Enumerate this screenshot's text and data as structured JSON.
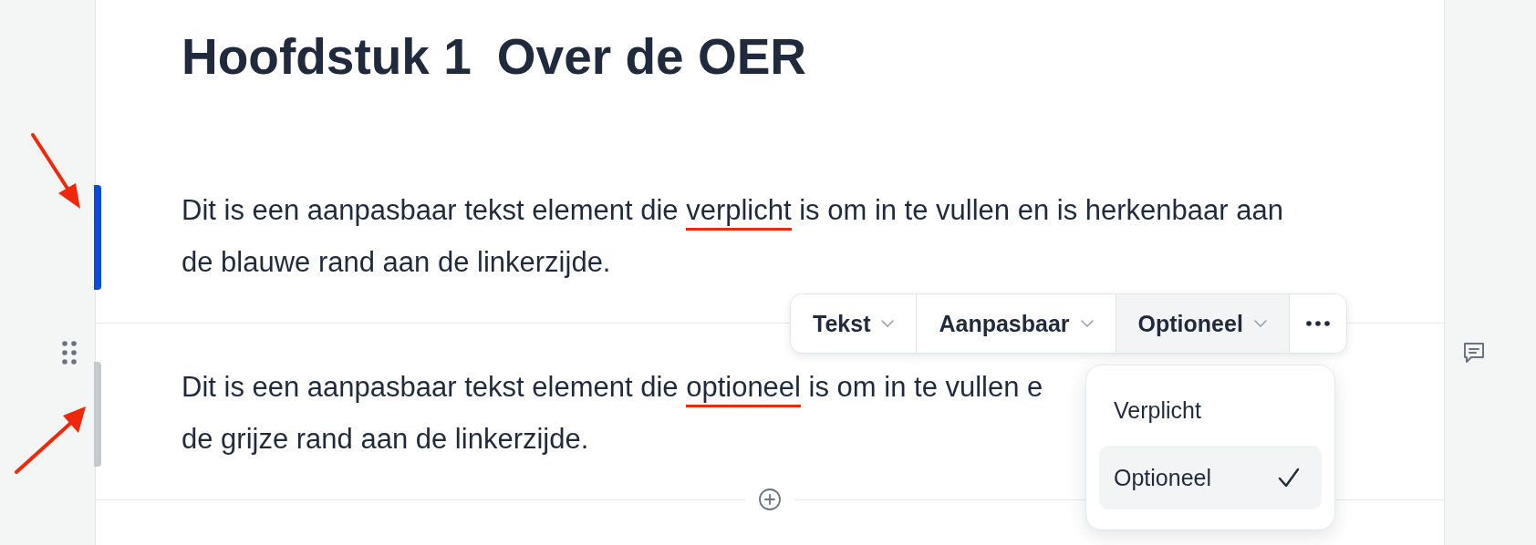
{
  "chapter": {
    "number": "Hoofdstuk 1",
    "title": "Over de OER"
  },
  "blocks": [
    {
      "required": true,
      "arrow_from_below": false,
      "line_1_before": "Dit is een aanpasbaar tekst element die ",
      "marked": "verplicht",
      "line_1_after": " is om in te vullen en is herkenbaar aan",
      "line_2": "de blauwe rand aan de linkerzijde."
    },
    {
      "required": false,
      "arrow_from_below": true,
      "line_1_before": "Dit is een aanpasbaar tekst element die ",
      "marked": "optioneel",
      "line_1_after": " is om in te vullen e",
      "line_2": "de grijze rand aan de linkerzijde."
    }
  ],
  "toolbar": [
    {
      "label": "Tekst",
      "selected": false
    },
    {
      "label": "Aanpasbaar",
      "selected": false
    },
    {
      "label": "Optioneel",
      "selected": true
    }
  ],
  "dropdown": [
    {
      "label": "Verplicht",
      "selected": false
    },
    {
      "label": "Optioneel",
      "selected": true
    }
  ]
}
